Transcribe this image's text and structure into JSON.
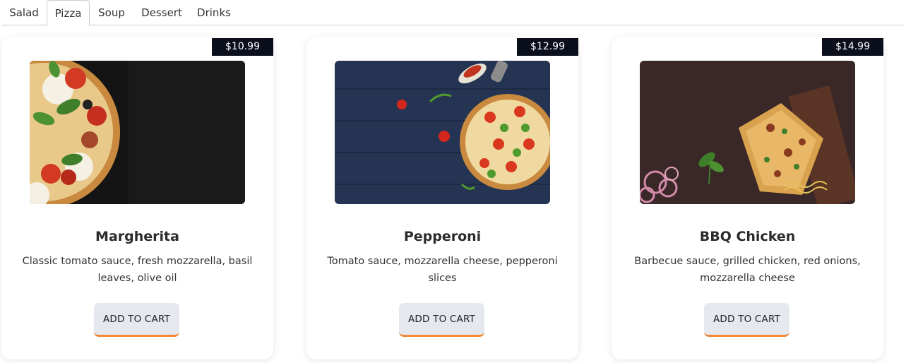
{
  "tabs": [
    {
      "label": "Salad"
    },
    {
      "label": "Pizza",
      "active": true
    },
    {
      "label": "Soup"
    },
    {
      "label": "Dessert"
    },
    {
      "label": "Drinks"
    }
  ],
  "items": [
    {
      "price": "$10.99",
      "name": "Margherita",
      "description": "Classic tomato sauce, fresh mozzarella, basil leaves, olive oil",
      "button": "ADD TO CART"
    },
    {
      "price": "$12.99",
      "name": "Pepperoni",
      "description": "Tomato sauce, mozzarella cheese, pepperoni slices",
      "button": "ADD TO CART"
    },
    {
      "price": "$14.99",
      "name": "BBQ Chicken",
      "description": "Barbecue sauce, grilled chicken, red onions, mozzarella cheese",
      "button": "ADD TO CART"
    }
  ],
  "colors": {
    "price_badge": "#0b0f1c",
    "button_bg": "#e5e8ee",
    "button_accent": "#f08a3a"
  }
}
